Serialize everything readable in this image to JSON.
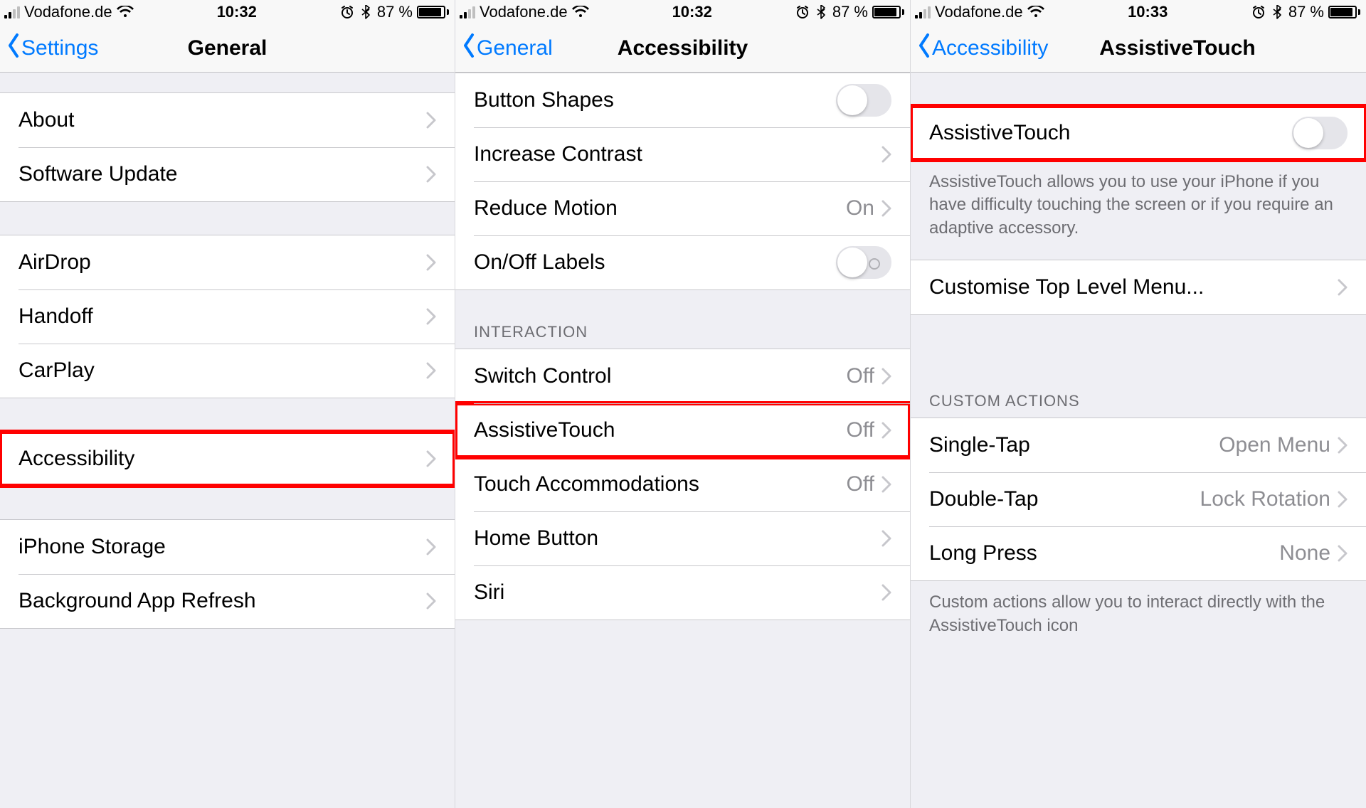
{
  "status": {
    "carrier": "Vodafone.de",
    "battery_pct": "87 %",
    "battery_fill": 87
  },
  "screens": [
    {
      "time": "10:32",
      "nav": {
        "back": "Settings",
        "title": "General"
      },
      "groups": [
        {
          "type": "spacer-sm"
        },
        {
          "type": "group",
          "rows": [
            {
              "label": "About",
              "chevron": true
            },
            {
              "label": "Software Update",
              "chevron": true
            }
          ]
        },
        {
          "type": "spacer"
        },
        {
          "type": "group",
          "rows": [
            {
              "label": "AirDrop",
              "chevron": true
            },
            {
              "label": "Handoff",
              "chevron": true
            },
            {
              "label": "CarPlay",
              "chevron": true
            }
          ]
        },
        {
          "type": "spacer"
        },
        {
          "type": "group",
          "rows": [
            {
              "label": "Accessibility",
              "chevron": true,
              "highlight": true
            }
          ]
        },
        {
          "type": "spacer"
        },
        {
          "type": "group",
          "rows": [
            {
              "label": "iPhone Storage",
              "chevron": true
            },
            {
              "label": "Background App Refresh",
              "chevron": true
            }
          ]
        }
      ]
    },
    {
      "time": "10:32",
      "nav": {
        "back": "General",
        "title": "Accessibility"
      },
      "groups": [
        {
          "type": "group",
          "rows": [
            {
              "label": "Button Shapes",
              "toggle": true
            },
            {
              "label": "Increase Contrast",
              "chevron": true
            },
            {
              "label": "Reduce Motion",
              "value": "On",
              "chevron": true
            },
            {
              "label": "On/Off Labels",
              "toggle": true,
              "toggle_labeled": true
            }
          ]
        },
        {
          "type": "header",
          "text": "INTERACTION"
        },
        {
          "type": "group",
          "rows": [
            {
              "label": "Switch Control",
              "value": "Off",
              "chevron": true
            },
            {
              "label": "AssistiveTouch",
              "value": "Off",
              "chevron": true,
              "highlight": true
            },
            {
              "label": "Touch Accommodations",
              "value": "Off",
              "chevron": true
            },
            {
              "label": "Home Button",
              "chevron": true
            },
            {
              "label": "Siri",
              "chevron": true
            }
          ]
        }
      ]
    },
    {
      "time": "10:33",
      "nav": {
        "back": "Accessibility",
        "title": "AssistiveTouch",
        "shift": true
      },
      "groups": [
        {
          "type": "spacer"
        },
        {
          "type": "group",
          "rows": [
            {
              "label": "AssistiveTouch",
              "toggle": true,
              "highlight": true
            }
          ]
        },
        {
          "type": "footer",
          "text": "AssistiveTouch allows you to use your iPhone if you have difficulty touching the screen or if you require an adaptive accessory."
        },
        {
          "type": "spacer-sm"
        },
        {
          "type": "group",
          "rows": [
            {
              "label": "Customise Top Level Menu...",
              "chevron": true
            }
          ]
        },
        {
          "type": "spacer-lg"
        },
        {
          "type": "header",
          "text": "CUSTOM ACTIONS"
        },
        {
          "type": "group",
          "rows": [
            {
              "label": "Single-Tap",
              "value": "Open Menu",
              "chevron": true
            },
            {
              "label": "Double-Tap",
              "value": "Lock Rotation",
              "chevron": true
            },
            {
              "label": "Long Press",
              "value": "None",
              "chevron": true
            }
          ]
        },
        {
          "type": "footer",
          "text": "Custom actions allow you to interact directly with the AssistiveTouch icon"
        }
      ]
    }
  ]
}
